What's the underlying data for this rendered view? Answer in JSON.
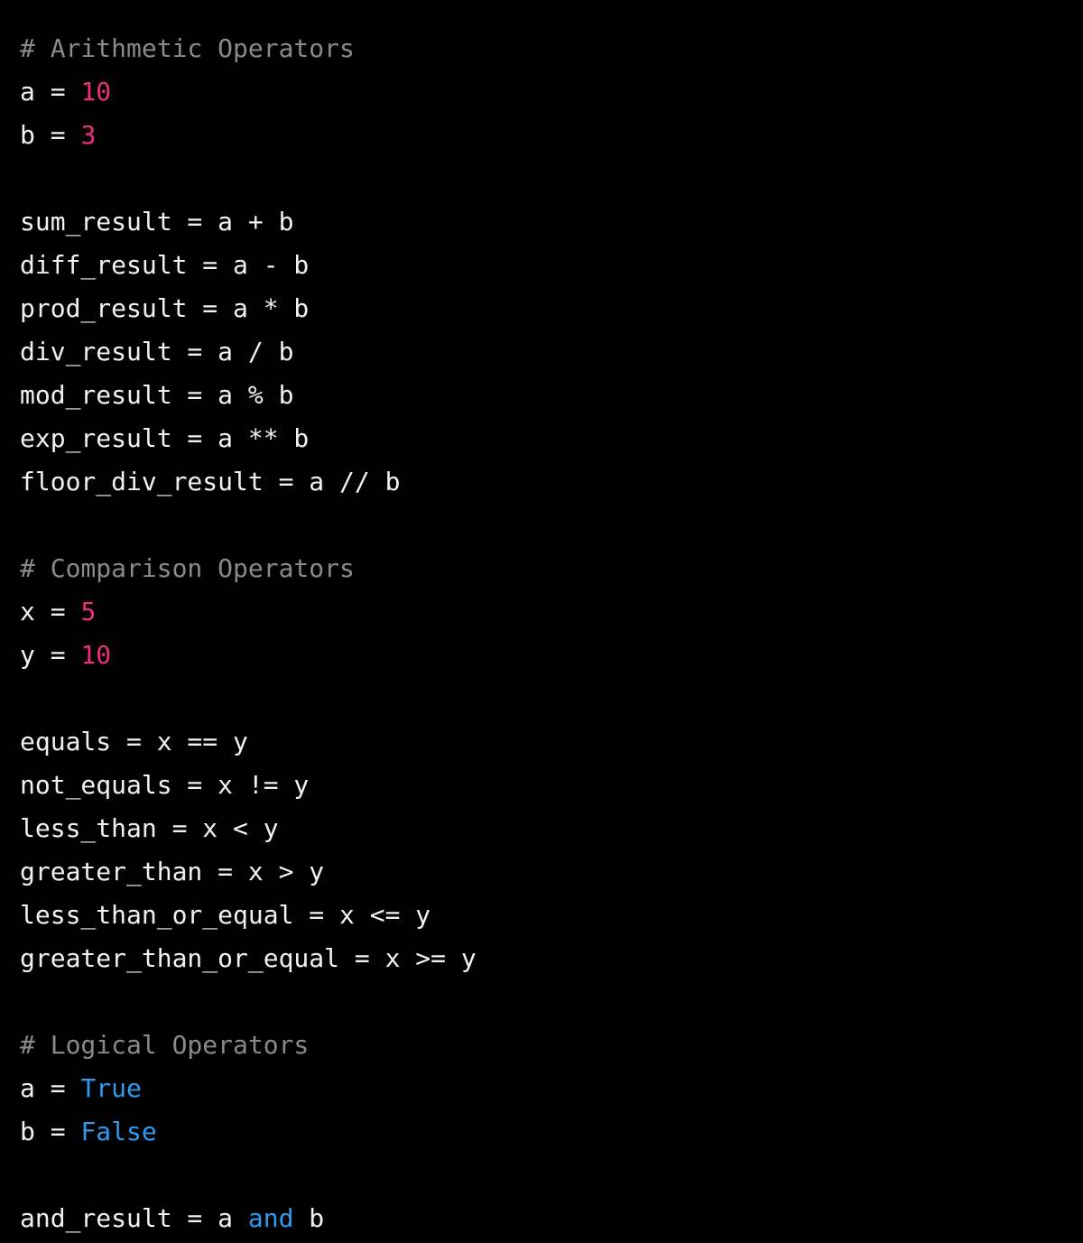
{
  "editor": {
    "language": "python",
    "background_color": "#000000",
    "colors": {
      "text": "#f2f2f2",
      "comment": "#8a8a8a",
      "number": "#f02d7e",
      "keyword": "#2e9bf0"
    }
  },
  "code": {
    "lines": [
      {
        "id": "line-1",
        "type": "comment",
        "tokens": [
          {
            "t": "comment",
            "s": "# Arithmetic Operators"
          }
        ]
      },
      {
        "id": "line-2",
        "type": "code",
        "tokens": [
          {
            "t": "plain",
            "s": "a = "
          },
          {
            "t": "number",
            "s": "10"
          }
        ]
      },
      {
        "id": "line-3",
        "type": "code",
        "tokens": [
          {
            "t": "plain",
            "s": "b = "
          },
          {
            "t": "number",
            "s": "3"
          }
        ]
      },
      {
        "id": "line-4",
        "type": "blank",
        "tokens": [
          {
            "t": "plain",
            "s": ""
          }
        ]
      },
      {
        "id": "line-5",
        "type": "code",
        "tokens": [
          {
            "t": "plain",
            "s": "sum_result = a + b"
          }
        ]
      },
      {
        "id": "line-6",
        "type": "code",
        "tokens": [
          {
            "t": "plain",
            "s": "diff_result = a - b"
          }
        ]
      },
      {
        "id": "line-7",
        "type": "code",
        "tokens": [
          {
            "t": "plain",
            "s": "prod_result = a * b"
          }
        ]
      },
      {
        "id": "line-8",
        "type": "code",
        "tokens": [
          {
            "t": "plain",
            "s": "div_result = a / b"
          }
        ]
      },
      {
        "id": "line-9",
        "type": "code",
        "tokens": [
          {
            "t": "plain",
            "s": "mod_result = a % b"
          }
        ]
      },
      {
        "id": "line-10",
        "type": "code",
        "tokens": [
          {
            "t": "plain",
            "s": "exp_result = a ** b"
          }
        ]
      },
      {
        "id": "line-11",
        "type": "code",
        "tokens": [
          {
            "t": "plain",
            "s": "floor_div_result = a // b"
          }
        ]
      },
      {
        "id": "line-12",
        "type": "blank",
        "tokens": [
          {
            "t": "plain",
            "s": ""
          }
        ]
      },
      {
        "id": "line-13",
        "type": "comment",
        "tokens": [
          {
            "t": "comment",
            "s": "# Comparison Operators"
          }
        ]
      },
      {
        "id": "line-14",
        "type": "code",
        "tokens": [
          {
            "t": "plain",
            "s": "x = "
          },
          {
            "t": "number",
            "s": "5"
          }
        ]
      },
      {
        "id": "line-15",
        "type": "code",
        "tokens": [
          {
            "t": "plain",
            "s": "y = "
          },
          {
            "t": "number",
            "s": "10"
          }
        ]
      },
      {
        "id": "line-16",
        "type": "blank",
        "tokens": [
          {
            "t": "plain",
            "s": ""
          }
        ]
      },
      {
        "id": "line-17",
        "type": "code",
        "tokens": [
          {
            "t": "plain",
            "s": "equals = x == y"
          }
        ]
      },
      {
        "id": "line-18",
        "type": "code",
        "tokens": [
          {
            "t": "plain",
            "s": "not_equals = x != y"
          }
        ]
      },
      {
        "id": "line-19",
        "type": "code",
        "tokens": [
          {
            "t": "plain",
            "s": "less_than = x < y"
          }
        ]
      },
      {
        "id": "line-20",
        "type": "code",
        "tokens": [
          {
            "t": "plain",
            "s": "greater_than = x > y"
          }
        ]
      },
      {
        "id": "line-21",
        "type": "code",
        "tokens": [
          {
            "t": "plain",
            "s": "less_than_or_equal = x <= y"
          }
        ]
      },
      {
        "id": "line-22",
        "type": "code",
        "tokens": [
          {
            "t": "plain",
            "s": "greater_than_or_equal = x >= y"
          }
        ]
      },
      {
        "id": "line-23",
        "type": "blank",
        "tokens": [
          {
            "t": "plain",
            "s": ""
          }
        ]
      },
      {
        "id": "line-24",
        "type": "comment",
        "tokens": [
          {
            "t": "comment",
            "s": "# Logical Operators"
          }
        ]
      },
      {
        "id": "line-25",
        "type": "code",
        "tokens": [
          {
            "t": "plain",
            "s": "a = "
          },
          {
            "t": "keyword",
            "s": "True"
          }
        ]
      },
      {
        "id": "line-26",
        "type": "code",
        "tokens": [
          {
            "t": "plain",
            "s": "b = "
          },
          {
            "t": "keyword",
            "s": "False"
          }
        ]
      },
      {
        "id": "line-27",
        "type": "blank",
        "tokens": [
          {
            "t": "plain",
            "s": ""
          }
        ]
      },
      {
        "id": "line-28",
        "type": "code",
        "tokens": [
          {
            "t": "plain",
            "s": "and_result = a "
          },
          {
            "t": "keyword",
            "s": "and"
          },
          {
            "t": "plain",
            "s": " b"
          }
        ]
      }
    ]
  }
}
